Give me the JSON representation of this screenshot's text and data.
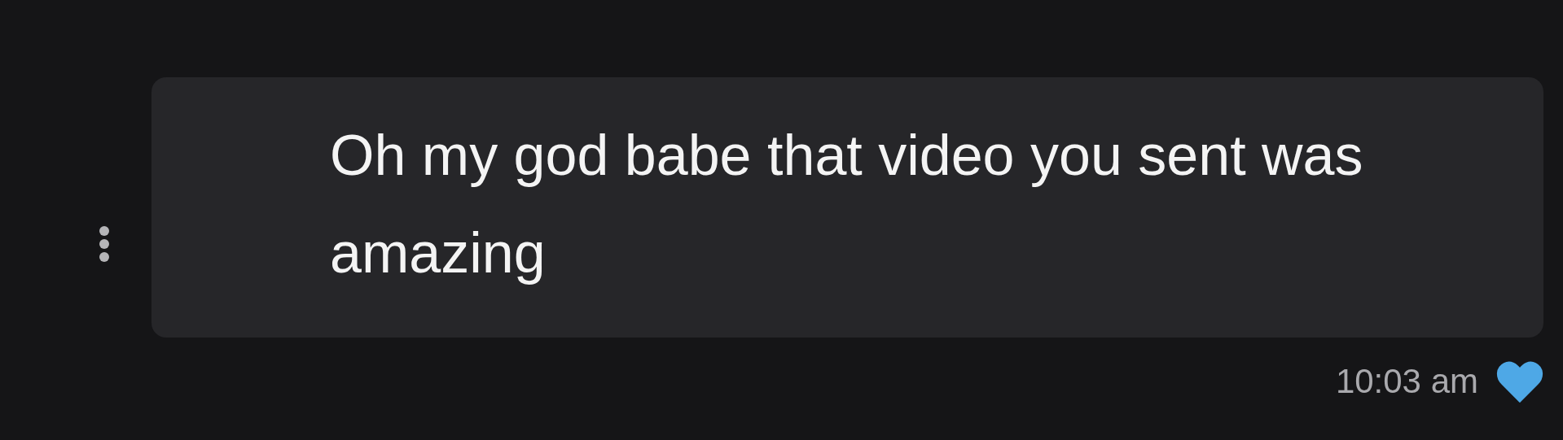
{
  "message": {
    "text": "Oh my god babe that video you sent was amazing",
    "time": "10:03 am",
    "liked": true
  }
}
